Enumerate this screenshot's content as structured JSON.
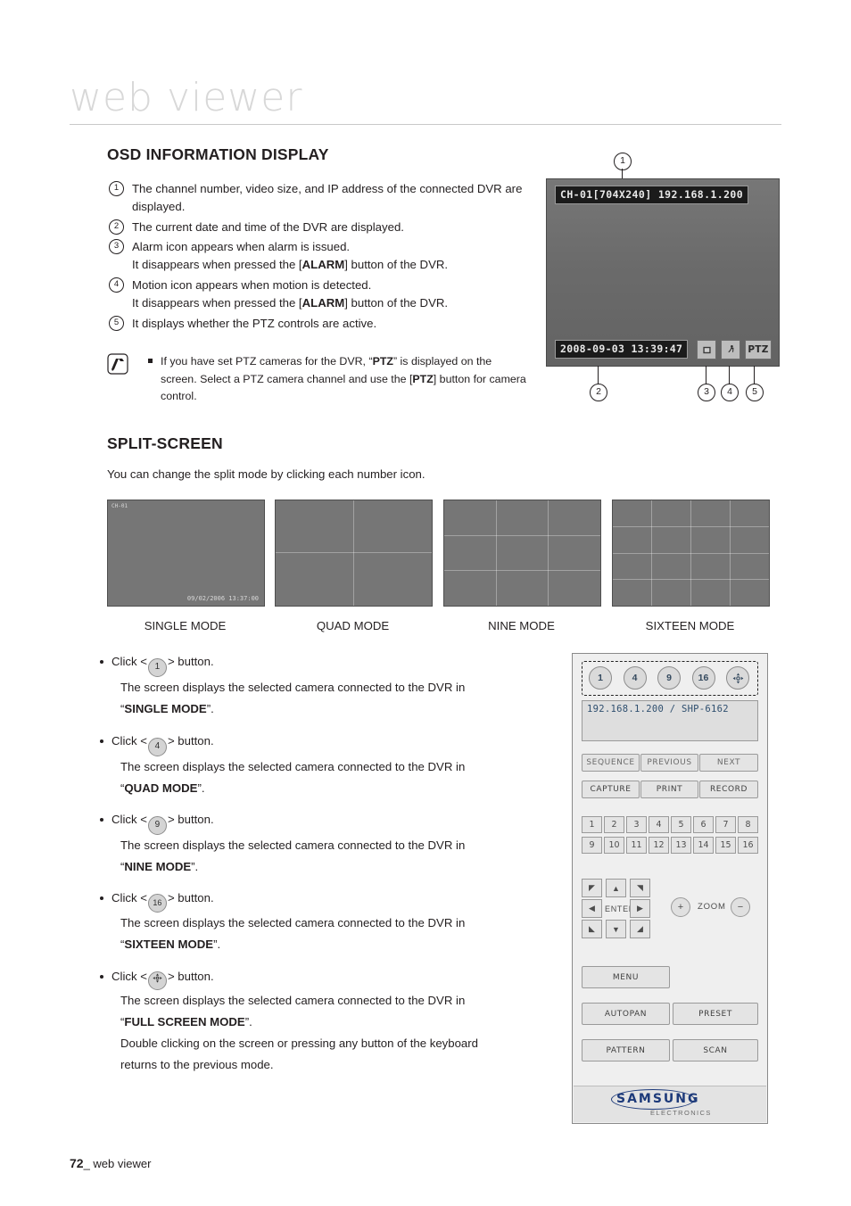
{
  "header": {
    "title": "web viewer"
  },
  "osd": {
    "heading": "OSD INFORMATION DISPLAY",
    "items": [
      {
        "num": "1",
        "text_plain": "The channel number, video size, and IP address of the connected DVR are displayed."
      },
      {
        "num": "2",
        "text_plain": "The current date and time of the DVR are displayed."
      },
      {
        "num": "3",
        "text_plain": "Alarm icon appears when alarm is issued.\nIt disappears when pressed the [ALARM] button of the DVR."
      },
      {
        "num": "4",
        "text_plain": "Motion icon appears when motion is detected.\nIt disappears when pressed the [ALARM] button of the DVR."
      },
      {
        "num": "5",
        "text_plain": "It displays whether the PTZ controls are active."
      }
    ],
    "note": "If you have set PTZ cameras for the DVR, “PTZ” is displayed on the screen. Select a PTZ camera channel and use the [PTZ] button for camera control.",
    "preview": {
      "channel_label": "CH-01[704X240] 192.168.1.200",
      "datetime": "2008-09-03 13:39:47",
      "icons": [
        "alarm-icon",
        "motion-icon",
        "PTZ"
      ],
      "ptz_text": "PTZ",
      "callouts": [
        "1",
        "2",
        "3",
        "4",
        "5"
      ]
    }
  },
  "split": {
    "heading": "SPLIT-SCREEN",
    "intro": "You can change the split mode by clicking each number icon.",
    "thumbs": [
      {
        "caption": "SINGLE MODE",
        "cells": 1,
        "overlay_time": "09/02/2006 13:37:00",
        "overlay_ch": "CH-01"
      },
      {
        "caption": "QUAD MODE",
        "cells": 4
      },
      {
        "caption": "NINE MODE",
        "cells": 9
      },
      {
        "caption": "SIXTEEN MODE",
        "cells": 16
      }
    ],
    "bullets": [
      {
        "icon": "1",
        "click_prefix": "Click <",
        "click_suffix": "> button.",
        "desc": "The screen displays the selected camera connected to the DVR in",
        "mode": "SINGLE MODE",
        "quote_close": "”."
      },
      {
        "icon": "4",
        "click_prefix": "Click <",
        "click_suffix": "> button.",
        "desc": "The screen displays the selected camera connected to the DVR in",
        "mode": "QUAD MODE",
        "quote_close": "”."
      },
      {
        "icon": "9",
        "click_prefix": "Click <",
        "click_suffix": "> button.",
        "desc": "The screen displays the selected camera connected to the DVR in",
        "mode": "NINE MODE",
        "quote_close": "”."
      },
      {
        "icon": "16",
        "click_prefix": "Click <",
        "click_suffix": "> button.",
        "desc": "The screen displays the selected camera connected to the DVR in",
        "mode": "SIXTEEN MODE",
        "quote_close": "”."
      },
      {
        "icon": "full-screen-icon",
        "click_prefix": "Click <",
        "click_suffix": "> button.",
        "desc": "The screen displays the selected camera connected to the DVR in",
        "mode": "FULL SCREEN MODE",
        "quote_close": "”.",
        "extra": "Double clicking on the screen or pressing any button of the keyboard returns to the previous mode."
      }
    ]
  },
  "panel": {
    "mode_buttons": [
      "1",
      "4",
      "9",
      "16",
      "full-screen-icon"
    ],
    "address": "192.168.1.200  / SHP-6162",
    "row_sequence": [
      "SEQUENCE",
      "PREVIOUS",
      "NEXT"
    ],
    "row_capture": [
      "CAPTURE",
      "PRINT",
      "RECORD"
    ],
    "channel_numbers_row1": [
      "1",
      "2",
      "3",
      "4",
      "5",
      "6",
      "7",
      "8"
    ],
    "channel_numbers_row2": [
      "9",
      "10",
      "11",
      "12",
      "13",
      "14",
      "15",
      "16"
    ],
    "enter_label": "ENTER",
    "zoom_label": "ZOOM",
    "zoom_in": "+",
    "zoom_out": "−",
    "menu": "MENU",
    "autopan": "AUTOPAN",
    "preset": "PRESET",
    "pattern": "PATTERN",
    "scan": "SCAN",
    "brand": "SAMSUNG",
    "brand_sub": "ELECTRONICS"
  },
  "footer": {
    "page": "72",
    "text": "_ web viewer"
  }
}
